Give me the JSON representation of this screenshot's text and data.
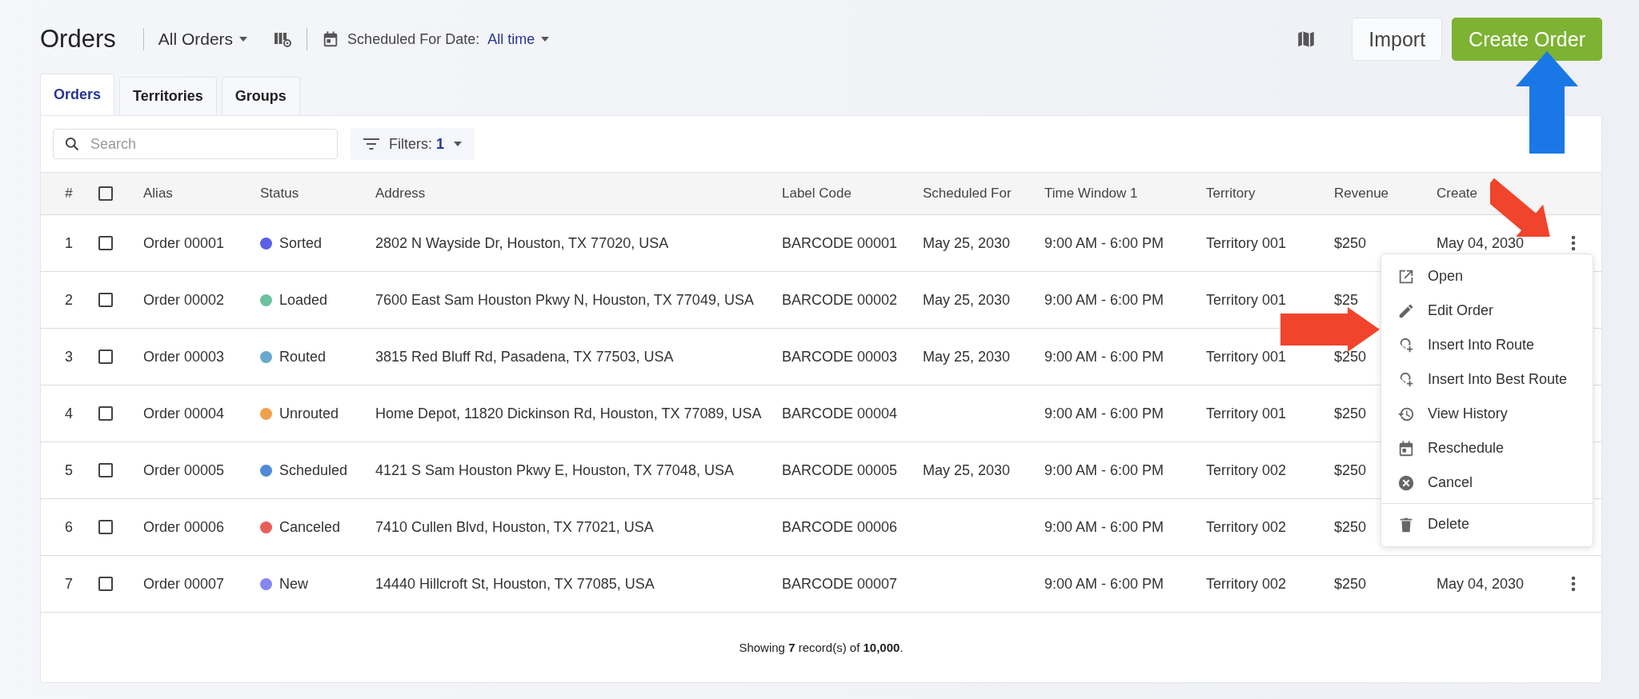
{
  "header": {
    "title": "Orders",
    "view_selector": "All Orders",
    "date_filter": {
      "label": "Scheduled For Date:",
      "value": "All time"
    },
    "buttons": [
      {
        "label": "Import",
        "kind": "secondary"
      },
      {
        "label": "Create Order",
        "kind": "primary"
      }
    ]
  },
  "tabs": [
    {
      "label": "Orders",
      "selected": true
    },
    {
      "label": "Territories",
      "selected": false
    },
    {
      "label": "Groups",
      "selected": false
    }
  ],
  "search": {
    "placeholder": "Search"
  },
  "filters": {
    "label": "Filters:",
    "count": "1"
  },
  "table": {
    "select_all_checked": false,
    "columns": [
      "#",
      "Alias",
      "Status",
      "Address",
      "Label Code",
      "Scheduled For",
      "Time Window 1",
      "Territory",
      "Revenue",
      "Create"
    ],
    "rows": [
      {
        "number": "1",
        "checked": false,
        "alias": "Order 00001",
        "status": "Sorted",
        "color": "#5a61e6",
        "address": "2802 N Wayside Dr, Houston, TX 77020, USA",
        "label_code": "BARCODE 00001",
        "scheduled_for": "May 25, 2030",
        "time_window": "9:00 AM - 6:00 PM",
        "territory": "Territory 001",
        "revenue": "$250",
        "created": "May 04, 2030"
      },
      {
        "number": "2",
        "checked": false,
        "alias": "Order 00002",
        "status": "Loaded",
        "color": "#6cc1a0",
        "address": "7600 East Sam Houston Pkwy N, Houston, TX 77049, USA",
        "label_code": "BARCODE 00002",
        "scheduled_for": "May 25, 2030",
        "time_window": "9:00 AM - 6:00 PM",
        "territory": "Territory 001",
        "revenue": "$25"
      },
      {
        "number": "3",
        "checked": false,
        "alias": "Order 00003",
        "status": "Routed",
        "color": "#67a8cc",
        "address": "3815 Red Bluff Rd, Pasadena, TX 77503, USA",
        "label_code": "BARCODE 00003",
        "scheduled_for": "May 25, 2030",
        "time_window": "9:00 AM - 6:00 PM",
        "territory": "Territory 001",
        "revenue": "$250"
      },
      {
        "number": "4",
        "checked": false,
        "alias": "Order 00004",
        "status": "Unrouted",
        "color": "#f0a14a",
        "address": "Home Depot, 11820 Dickinson Rd, Houston, TX 77089, USA",
        "label_code": "BARCODE 00004",
        "time_window": "9:00 AM - 6:00 PM",
        "territory": "Territory 001",
        "revenue": "$250"
      },
      {
        "number": "5",
        "checked": false,
        "alias": "Order 00005",
        "status": "Scheduled",
        "color": "#4f8bd6",
        "address": "4121 S Sam Houston Pkwy E, Houston, TX 77048, USA",
        "label_code": "BARCODE 00005",
        "scheduled_for": "May 25, 2030",
        "time_window": "9:00 AM - 6:00 PM",
        "territory": "Territory 002",
        "revenue": "$250"
      },
      {
        "number": "6",
        "checked": false,
        "alias": "Order 00006",
        "status": "Canceled",
        "color": "#e65e5a",
        "address": "7410 Cullen Blvd, Houston, TX 77021, USA",
        "label_code": "BARCODE 00006",
        "time_window": "9:00 AM - 6:00 PM",
        "territory": "Territory 002",
        "revenue": "$250"
      },
      {
        "number": "7",
        "checked": false,
        "alias": "Order 00007",
        "status": "New",
        "color": "#8587f0",
        "address": "14440 Hillcroft St, Houston, TX 77085, USA",
        "label_code": "BARCODE 00007",
        "time_window": "9:00 AM - 6:00 PM",
        "territory": "Territory 002",
        "revenue": "$250",
        "created": "May 04, 2030"
      }
    ]
  },
  "footer": "Showing **7** record(s) of **10,000**.",
  "context_menu": {
    "groups": [
      [
        "Open",
        "Edit Order",
        "Insert Into Route",
        "Insert Into Best Route",
        "View History",
        "Reschedule",
        "Cancel"
      ],
      [
        "Delete"
      ]
    ]
  },
  "annotations": [
    {
      "kind": "arrow",
      "color": "#1a78e6"
    },
    {
      "kind": "arrow",
      "color": "#f0442c"
    },
    {
      "kind": "arrow",
      "color": "#f0442c"
    }
  ]
}
